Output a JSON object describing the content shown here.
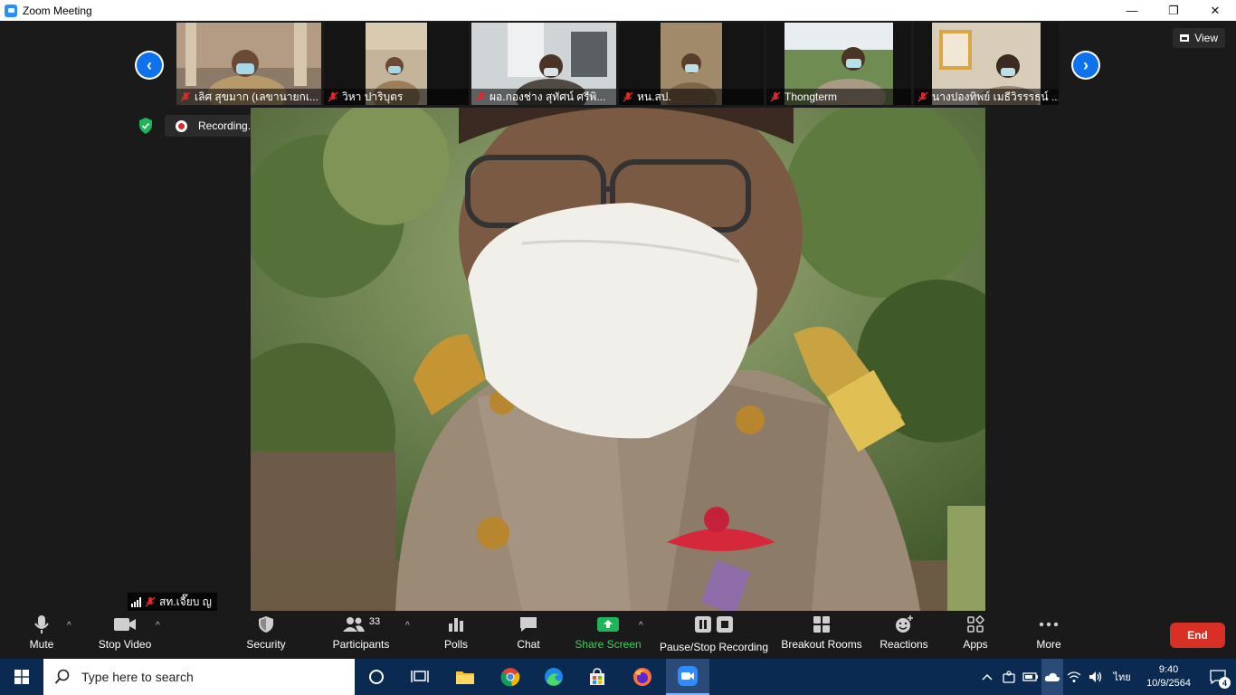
{
  "window": {
    "title": "Zoom Meeting",
    "minimize": "—",
    "restore": "❐",
    "close": "✕"
  },
  "view_button": {
    "label": "View"
  },
  "thumbnails": [
    {
      "name": "เลิศ สุขมาก (เลขานายกเ..."
    },
    {
      "name": "วิหา ปาริบุตร"
    },
    {
      "name": "ผอ.กองช่าง สุทัศน์ ศรีพิ..."
    },
    {
      "name": "หน.สป."
    },
    {
      "name": "Thongterm"
    },
    {
      "name": "นางปองทิพย์ เมธีวิรรรธน์ ..."
    }
  ],
  "recording": {
    "label": "Recording..."
  },
  "speaker": {
    "name": "สท.เจี๊ยบ ญ"
  },
  "toolbar": {
    "mute": "Mute",
    "stop_video": "Stop Video",
    "security": "Security",
    "participants": "Participants",
    "participants_count": "33",
    "polls": "Polls",
    "chat": "Chat",
    "share_screen": "Share Screen",
    "pause_recording": "Pause/Stop Recording",
    "breakout_rooms": "Breakout Rooms",
    "reactions": "Reactions",
    "apps": "Apps",
    "more": "More",
    "end": "End"
  },
  "taskbar": {
    "search_placeholder": "Type here to search",
    "language": "ไทย",
    "time": "9:40",
    "date": "10/9/2564",
    "notifications": "4"
  }
}
